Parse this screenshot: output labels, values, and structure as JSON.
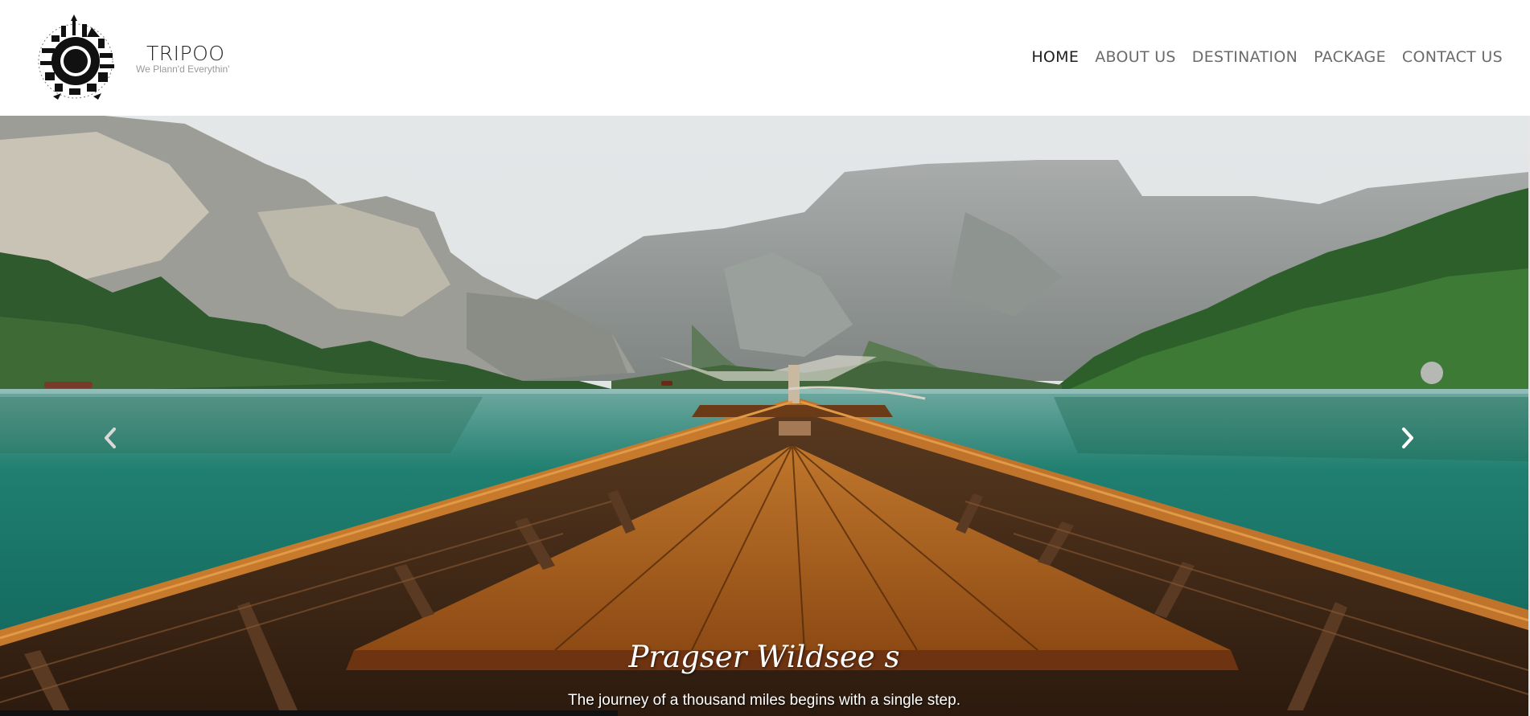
{
  "brand": {
    "name": "TRIPOO",
    "tagline": "We Plann'd Everythin'"
  },
  "nav": {
    "items": [
      {
        "label": "HOME",
        "active": true
      },
      {
        "label": "ABOUT US",
        "active": false
      },
      {
        "label": "DESTINATION",
        "active": false
      },
      {
        "label": "PACKAGE",
        "active": false
      },
      {
        "label": "CONTACT US",
        "active": false
      }
    ]
  },
  "hero": {
    "title": "Pragser Wildsee s",
    "subtitle": "The journey of a thousand miles begins with a single step.",
    "prev_icon": "chevron-left-icon",
    "next_icon": "chevron-right-icon"
  },
  "colors": {
    "nav_text": "#6b6b6b",
    "nav_active": "#1e1e1e",
    "water": "#1e8273",
    "boat_wood": "#b56a26"
  }
}
